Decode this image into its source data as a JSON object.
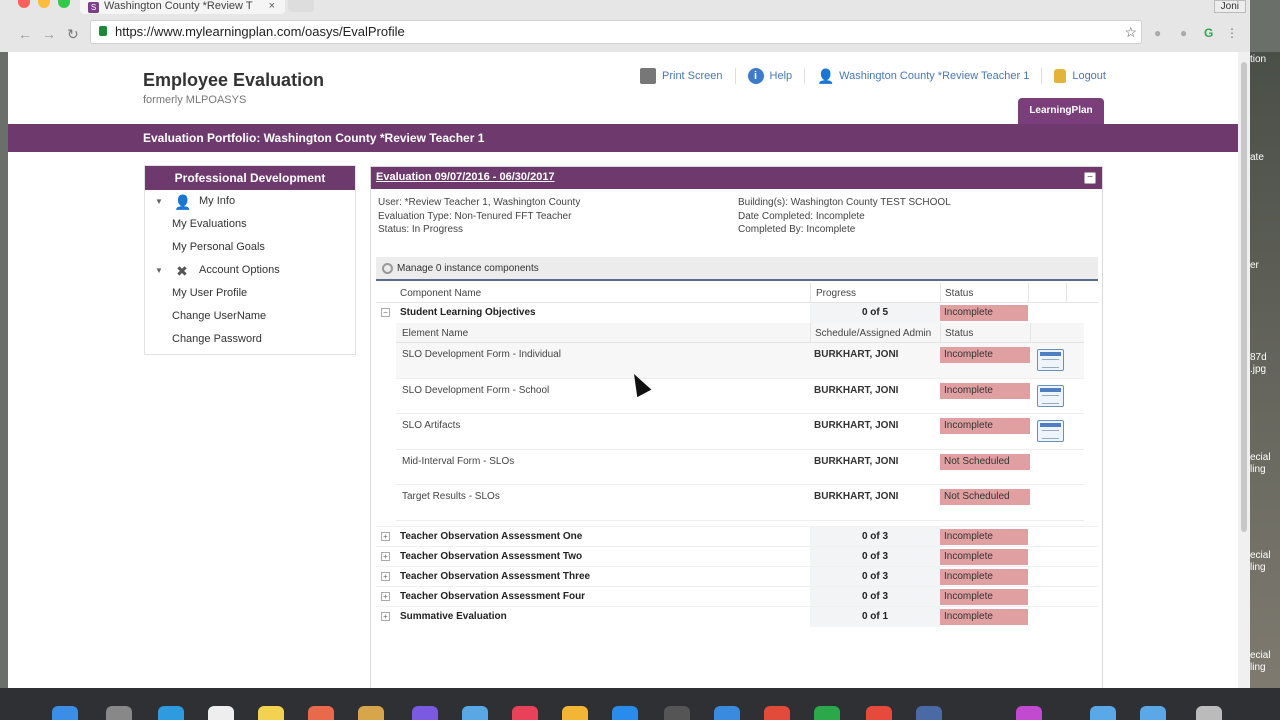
{
  "browser": {
    "tab_title": "Washington County *Review T",
    "tab_close": "×",
    "url": "https://www.mylearningplan.com/oasys/EvalProfile",
    "user_badge": "Joni",
    "favicon_letter": "S"
  },
  "header": {
    "title": "Employee Evaluation",
    "subtitle": "formerly MLPOASYS",
    "links": {
      "print": "Print Screen",
      "help": "Help",
      "user": "Washington County *Review Teacher 1",
      "logout": "Logout"
    },
    "learningplan_tab": "LearningPlan",
    "portfolio_title": "Evaluation Portfolio: Washington County *Review Teacher 1"
  },
  "sidebar": {
    "heading": "Professional Development",
    "sections": [
      {
        "label": "My Info",
        "items": [
          "My Evaluations",
          "My Personal Goals"
        ]
      },
      {
        "label": "Account Options",
        "items": [
          "My User Profile",
          "Change UserName",
          "Change Password"
        ]
      }
    ]
  },
  "evaluation": {
    "heading": "Evaluation 09/07/2016 - 06/30/2017",
    "user": "User: *Review Teacher 1, Washington County",
    "eval_type": "Evaluation Type: Non-Tenured FFT Teacher",
    "status": "Status: In Progress",
    "buildings": "Building(s): Washington County TEST SCHOOL",
    "date_completed": "Date Completed: Incomplete",
    "completed_by": "Completed By: Incomplete",
    "manage_label": "Manage 0 instance components"
  },
  "table": {
    "headers": {
      "component": "Component Name",
      "progress": "Progress",
      "status": "Status"
    },
    "expanded": {
      "name": "Student Learning Objectives",
      "progress": "0 of 5",
      "status": "Incomplete"
    },
    "sub_headers": {
      "element": "Element Name",
      "admin": "Schedule/Assigned Admin",
      "status": "Status"
    },
    "elements": [
      {
        "name": "SLO Development Form - Individual",
        "admin": "BURKHART, JONI",
        "status": "Incomplete",
        "has_form": true
      },
      {
        "name": "SLO Development Form - School",
        "admin": "BURKHART, JONI",
        "status": "Incomplete",
        "has_form": true
      },
      {
        "name": "SLO Artifacts",
        "admin": "BURKHART, JONI",
        "status": "Incomplete",
        "has_form": true
      },
      {
        "name": "Mid-Interval Form - SLOs",
        "admin": "BURKHART, JONI",
        "status": "Not Scheduled",
        "has_form": false
      },
      {
        "name": "Target Results - SLOs",
        "admin": "BURKHART, JONI",
        "status": "Not Scheduled",
        "has_form": false
      }
    ],
    "collapsed": [
      {
        "name": "Teacher Observation Assessment One",
        "progress": "0 of 3",
        "status": "Incomplete"
      },
      {
        "name": "Teacher Observation Assessment Two",
        "progress": "0 of 3",
        "status": "Incomplete"
      },
      {
        "name": "Teacher Observation Assessment Three",
        "progress": "0 of 3",
        "status": "Incomplete"
      },
      {
        "name": "Teacher Observation Assessment Four",
        "progress": "0 of 3",
        "status": "Incomplete"
      },
      {
        "name": "Summative Evaluation",
        "progress": "0 of 1",
        "status": "Incomplete"
      }
    ]
  },
  "desktop_labels": [
    "tion",
    "ate",
    "er",
    "87d",
    ".jpg",
    "ecial",
    "ling",
    "ecial",
    "ling",
    "ecial",
    "ling"
  ],
  "colors": {
    "brand_purple": "#6e3a6e",
    "status_pink": "#e0a0a2",
    "link_blue": "#4a78b3"
  },
  "icons": {
    "print": "printer-icon",
    "help": "help-icon",
    "user": "user-icon",
    "logout": "lock-icon",
    "my_info": "person-icon",
    "account": "tools-icon",
    "form": "form-document-icon"
  }
}
